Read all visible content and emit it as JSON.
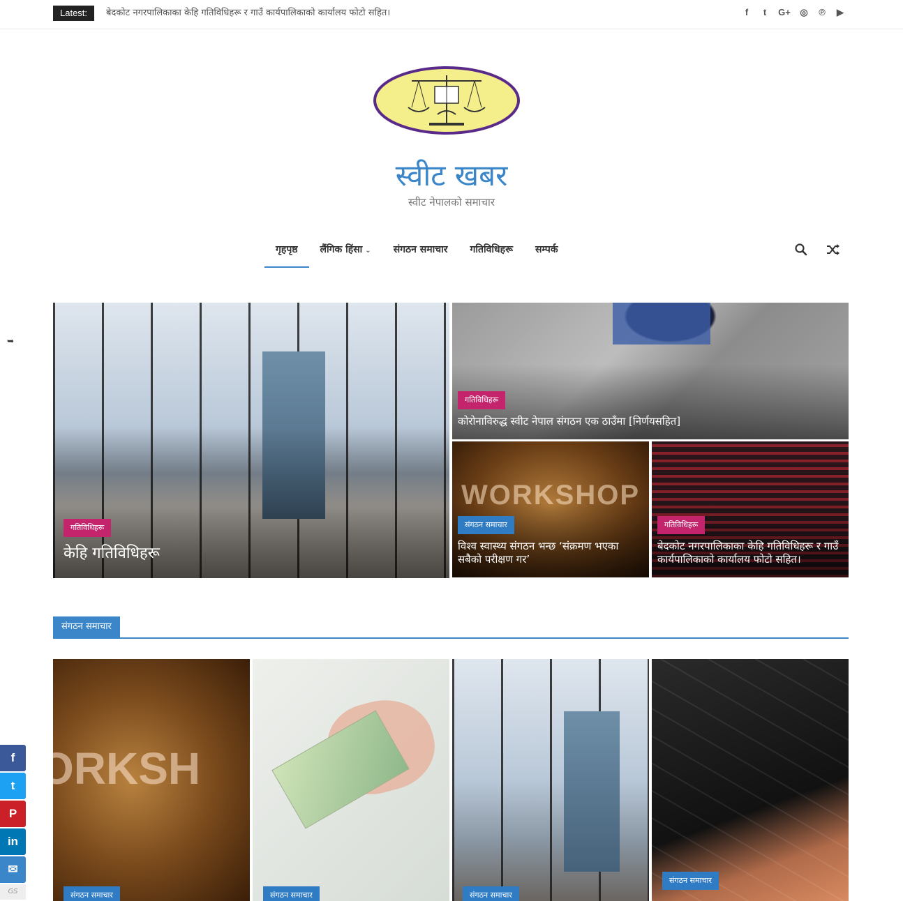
{
  "topbar": {
    "latest_label": "Latest:",
    "latest_text": "बेदकोट नगरपालिकाका केहि गतिविधिहरू र गाउँ कार्यपालिकाको कार्यालय फोटो सहित।",
    "social": [
      {
        "icon": "facebook-icon",
        "glyph": "f"
      },
      {
        "icon": "twitter-icon",
        "glyph": "t"
      },
      {
        "icon": "google-plus-icon",
        "glyph": "G+"
      },
      {
        "icon": "instagram-icon",
        "glyph": "◎"
      },
      {
        "icon": "pinterest-icon",
        "glyph": "℗"
      },
      {
        "icon": "youtube-icon",
        "glyph": "▶"
      }
    ]
  },
  "header": {
    "site_title": "स्वीट खबर",
    "tagline": "स्वीट नेपालको समाचार"
  },
  "nav": {
    "items": [
      "गृहपृष्ठ",
      "लैंगिक हिंसा",
      "संगठन समाचार",
      "गतिविधिहरू",
      "सम्पर्क"
    ],
    "active_index": 0,
    "dropdown_index": 1
  },
  "featured": [
    {
      "category": "गतिविधिहरू",
      "title": "केहि गतिविधिहरू",
      "tag_color": "#c4246c"
    },
    {
      "category": "गतिविधिहरू",
      "title": "कोरोनाविरुद्ध स्वीट नेपाल संगठन एक ठाउँमा [निर्णयसहित]",
      "tag_color": "#c4246c"
    },
    {
      "category": "संगठन समाचार",
      "title": "विश्व स्वास्थ्य संगठन भन्छ ‘संक्रमण भएका सबैको परीक्षण गर’",
      "tag_color": "#2f7cc4"
    },
    {
      "category": "गतिविधिहरू",
      "title": "बेदकोट नगरपालिकाका केहि गतिविधिहरू र गाउँ कार्यपालिकाको कार्यालय फोटो सहित।",
      "tag_color": "#c4246c"
    }
  ],
  "section": {
    "label": "संगठन समाचार",
    "cards": [
      {
        "category": "संगठन समाचार"
      },
      {
        "category": "संगठन समाचार"
      },
      {
        "category": "संगठन समाचार"
      },
      {
        "category": "संगठन समाचार"
      }
    ]
  },
  "share": [
    {
      "icon": "facebook-icon",
      "glyph": "f",
      "color": "#3b5998"
    },
    {
      "icon": "twitter-icon",
      "glyph": "t",
      "color": "#1da1f2"
    },
    {
      "icon": "pinterest-icon",
      "glyph": "P",
      "color": "#cb2027"
    },
    {
      "icon": "linkedin-icon",
      "glyph": "in",
      "color": "#0077b5"
    },
    {
      "icon": "email-icon",
      "glyph": "✉",
      "color": "#3a86c8"
    }
  ],
  "share_gs": "GS",
  "colors": {
    "accent": "#3a86c8",
    "pink": "#c4246c"
  }
}
